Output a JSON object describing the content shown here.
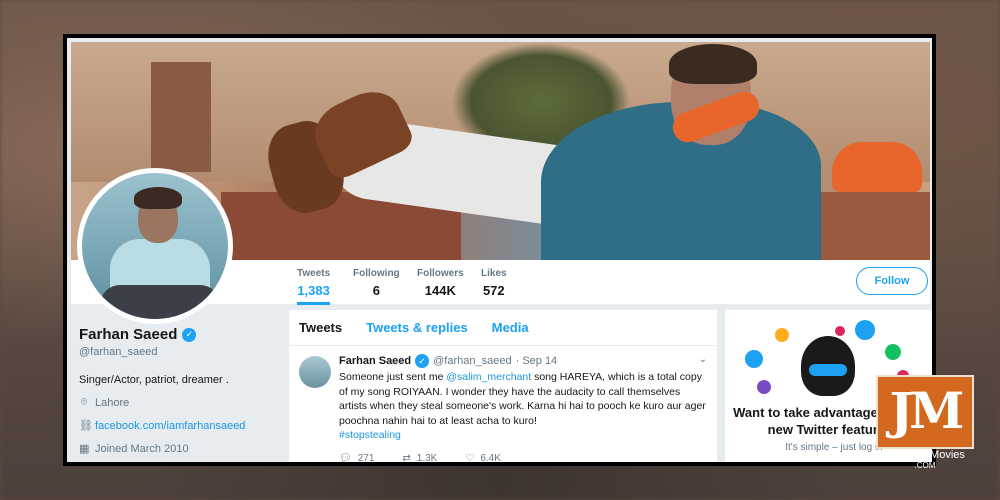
{
  "profile": {
    "name": "Farhan Saeed",
    "handle": "@farhan_saeed",
    "bio": "Singer/Actor, patriot, dreamer .",
    "location": "Lahore",
    "website": "facebook.com/iamfarhansaeed",
    "joined": "Joined March 2010"
  },
  "stats": [
    {
      "label": "Tweets",
      "value": "1,383",
      "active": true
    },
    {
      "label": "Following",
      "value": "6"
    },
    {
      "label": "Followers",
      "value": "144K"
    },
    {
      "label": "Likes",
      "value": "572"
    }
  ],
  "follow_label": "Follow",
  "tabs": [
    "Tweets",
    "Tweets & replies",
    "Media"
  ],
  "tweet": {
    "name": "Farhan Saeed",
    "handle": "@farhan_saeed",
    "time": "· Sep 14",
    "text_1": "Someone just sent me ",
    "mention": "@salim_merchant",
    "text_2": " song HAREYA, which is a total copy of my song ROIYAAN. I wonder they have the audacity to call themselves artists when they steal someone's work. Karna hi hai to pooch ke kuro aur ager poochna nahin hai to at least acha to kuro!",
    "hashtag": "#stopstealing",
    "replies": "271",
    "retweets": "1.3K",
    "likes": "6.4K"
  },
  "card": {
    "title": "Want to take advantage of all the new Twitter features?",
    "subtitle": "It's simple – just log in"
  },
  "watermark": {
    "letters": "JM",
    "name": "JhakaasMovies",
    "domain": ".COM"
  },
  "colors": {
    "accent": "#1da1f2",
    "watermark": "#d2691e"
  }
}
